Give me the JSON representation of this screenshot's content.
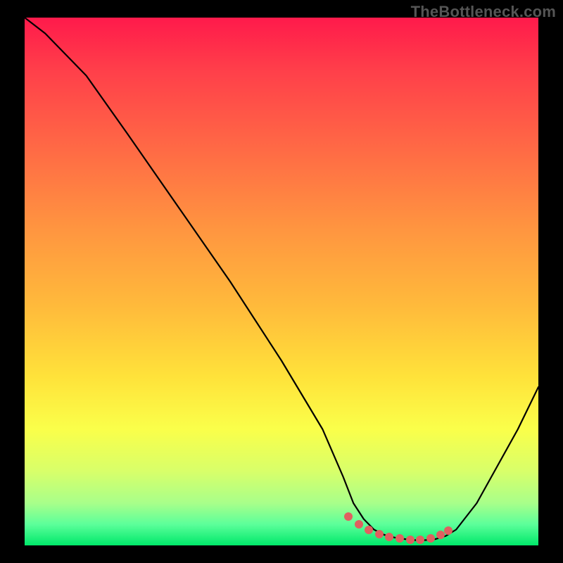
{
  "watermark": "TheBottleneck.com",
  "chart_data": {
    "type": "line",
    "title": "",
    "xlabel": "",
    "ylabel": "",
    "xlim": [
      0,
      100
    ],
    "ylim": [
      0,
      100
    ],
    "series": [
      {
        "name": "curve",
        "x": [
          0,
          4,
          8,
          12,
          20,
          30,
          40,
          50,
          58,
          62,
          64,
          66,
          68,
          70,
          72,
          74,
          76,
          78,
          80,
          82,
          84,
          88,
          92,
          96,
          100
        ],
        "y": [
          100,
          97,
          93,
          89,
          78,
          64,
          50,
          35,
          22,
          13,
          8,
          5,
          3,
          2,
          1.5,
          1.2,
          1,
          1,
          1.2,
          1.8,
          3,
          8,
          15,
          22,
          30
        ]
      }
    ],
    "markers": {
      "name": "optimal-zone",
      "x": [
        63,
        65,
        67,
        69,
        71,
        73,
        75,
        77,
        79,
        81,
        82.5
      ],
      "y": [
        5.5,
        4,
        3,
        2.2,
        1.6,
        1.3,
        1.1,
        1.1,
        1.3,
        2.0,
        2.8
      ]
    }
  }
}
